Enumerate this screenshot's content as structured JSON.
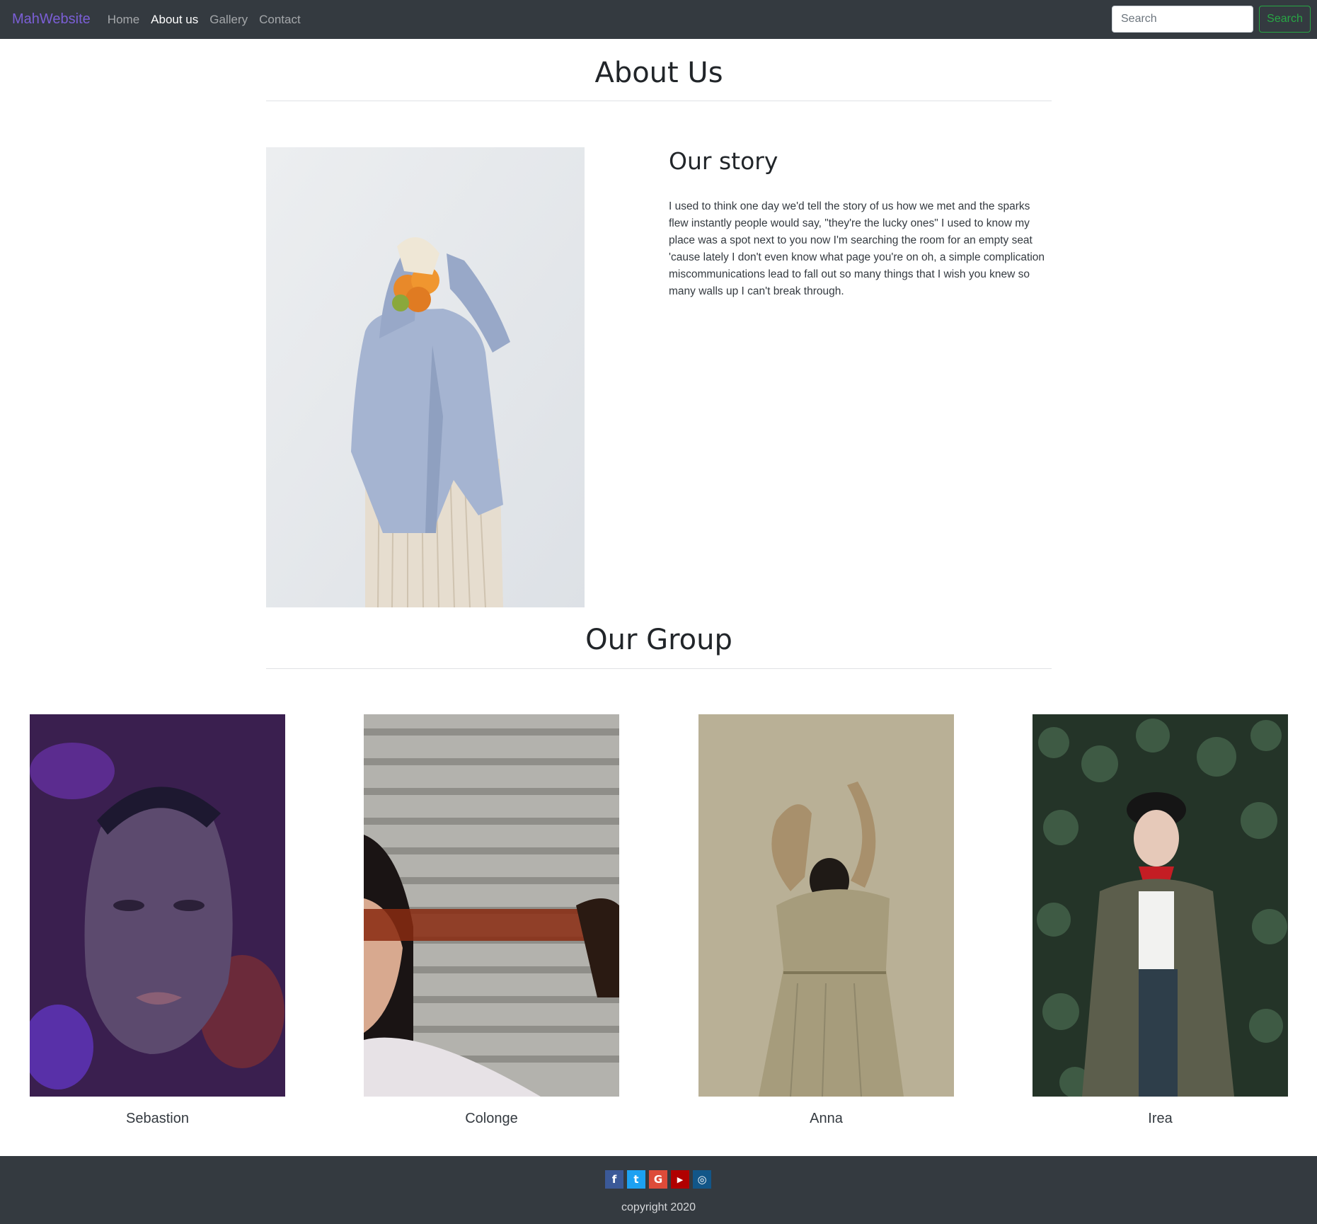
{
  "nav": {
    "brand": "MahWebsite",
    "links": [
      "Home",
      "About us",
      "Gallery",
      "Contact"
    ],
    "active": "About us",
    "search_placeholder": "Search",
    "search_button": "Search"
  },
  "about": {
    "title": "About Us",
    "story_heading": "Our story",
    "story_text": "I used to think one day we'd tell the story of us how we met and the sparks flew instantly people would say, \"they're the lucky ones\" I used to know my place was a spot next to you now I'm searching the room for an empty seat 'cause lately I don't even know what page you're on oh, a simple complication miscommunications lead to fall out so many things that I wish you knew so many walls up I can't break through."
  },
  "group": {
    "title": "Our Group",
    "members": [
      {
        "name": "Sebastion"
      },
      {
        "name": "Colonge"
      },
      {
        "name": "Anna"
      },
      {
        "name": "Irea"
      }
    ]
  },
  "footer": {
    "social": [
      {
        "icon": "facebook-icon",
        "glyph": "f",
        "color": "#3b5998"
      },
      {
        "icon": "twitter-icon",
        "glyph": "t",
        "color": "#1da1f2"
      },
      {
        "icon": "google-icon",
        "glyph": "G",
        "color": "#dd4b39"
      },
      {
        "icon": "youtube-icon",
        "glyph": "▶",
        "color": "#b00000"
      },
      {
        "icon": "instagram-icon",
        "glyph": "◎",
        "color": "#125688"
      }
    ],
    "copyright": "copyright 2020"
  }
}
